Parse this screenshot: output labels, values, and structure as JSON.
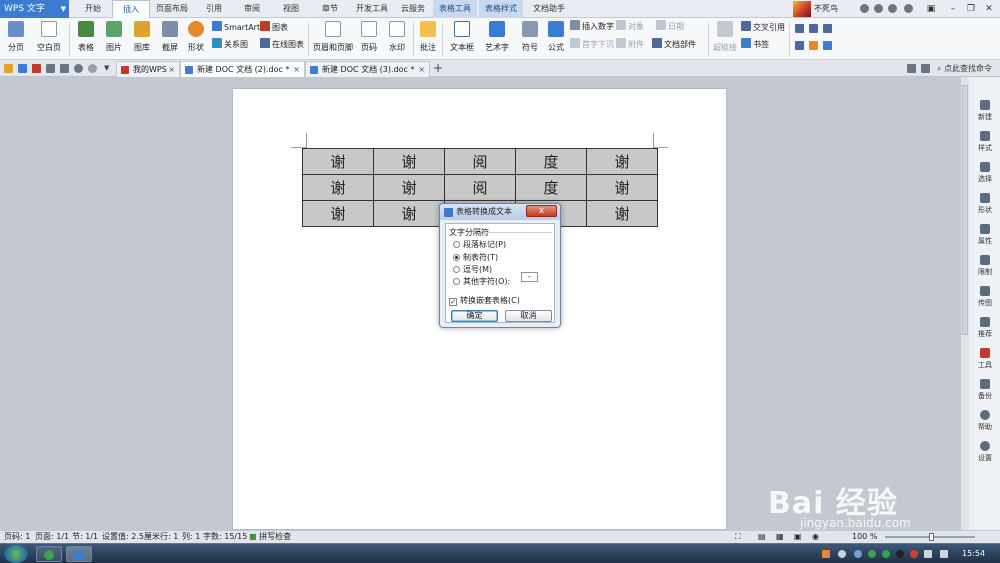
{
  "app": {
    "name": "WPS 文字"
  },
  "menu": {
    "tabs": [
      "开始",
      "插入",
      "页面布局",
      "引用",
      "审阅",
      "视图",
      "章节",
      "开发工具",
      "云服务",
      "表格工具",
      "表格样式",
      "文档助手"
    ],
    "active_tab": "插入"
  },
  "user": {
    "name": "不死鸟"
  },
  "ribbon": {
    "page_break": "分页",
    "blank_page": "空白页",
    "table": "表格",
    "picture": "图片",
    "gallery": "图库",
    "screenshot": "截屏",
    "shape": "形状",
    "smartart": "SmartArt",
    "chart": "图表",
    "relation": "关系图",
    "online_chart": "在线图表",
    "header_footer": "页眉和页脚",
    "page_number": "页码",
    "watermark": "水印",
    "comment": "批注",
    "textbox": "文本框",
    "wordart": "艺术字",
    "symbol": "符号",
    "formula": "公式",
    "insert_number": "插入数字",
    "object": "对象",
    "date": "日期",
    "drop_cap": "首字下沉",
    "attachment": "附件",
    "doc_parts": "文档部件",
    "hyperlink": "超链接",
    "cross_ref": "交叉引用",
    "bookmark": "书签"
  },
  "doc_tabs": [
    {
      "label": "我的WPS"
    },
    {
      "label": "新建 DOC 文档 (2).doc *"
    },
    {
      "label": "新建 DOC 文档 (3).doc *"
    }
  ],
  "find_command": "点此查找命令",
  "table": {
    "rows": [
      [
        "谢",
        "谢",
        "阅",
        "度",
        "谢"
      ],
      [
        "谢",
        "谢",
        "阅",
        "度",
        "谢"
      ],
      [
        "谢",
        "谢",
        "",
        "",
        "谢"
      ]
    ]
  },
  "dialog": {
    "title": "表格转换成文本",
    "close": "x",
    "group_label": "文字分隔符",
    "options": [
      "段落标记(P)",
      "制表符(T)",
      "逗号(M)",
      "其他字符(O):"
    ],
    "selected": "制表符(T)",
    "other_char_value": "-",
    "nested_label": "转换嵌套表格(C)",
    "nested_checked": true,
    "ok": "确定",
    "cancel": "取消"
  },
  "sidebar": [
    "新建",
    "样式",
    "选择",
    "形状",
    "属性",
    "限制",
    "传图",
    "推荐",
    "工具",
    "备份",
    "帮助",
    "设置"
  ],
  "status": {
    "page": "页码: 1",
    "pages": "页面: 1/1",
    "section": "节: 1/1",
    "setting": "设置值: 2.5厘米",
    "row": "行: 1",
    "col": "列: 1",
    "words": "字数: 15/15",
    "spell": "拼写检查",
    "zoom": "100 %"
  },
  "clock": "15:54",
  "watermark": {
    "logo": "Bai 经验",
    "url": "jingyan.baidu.com"
  },
  "colors": {
    "accent": "#3b7bd1",
    "dialog_close": "#c23a23"
  }
}
